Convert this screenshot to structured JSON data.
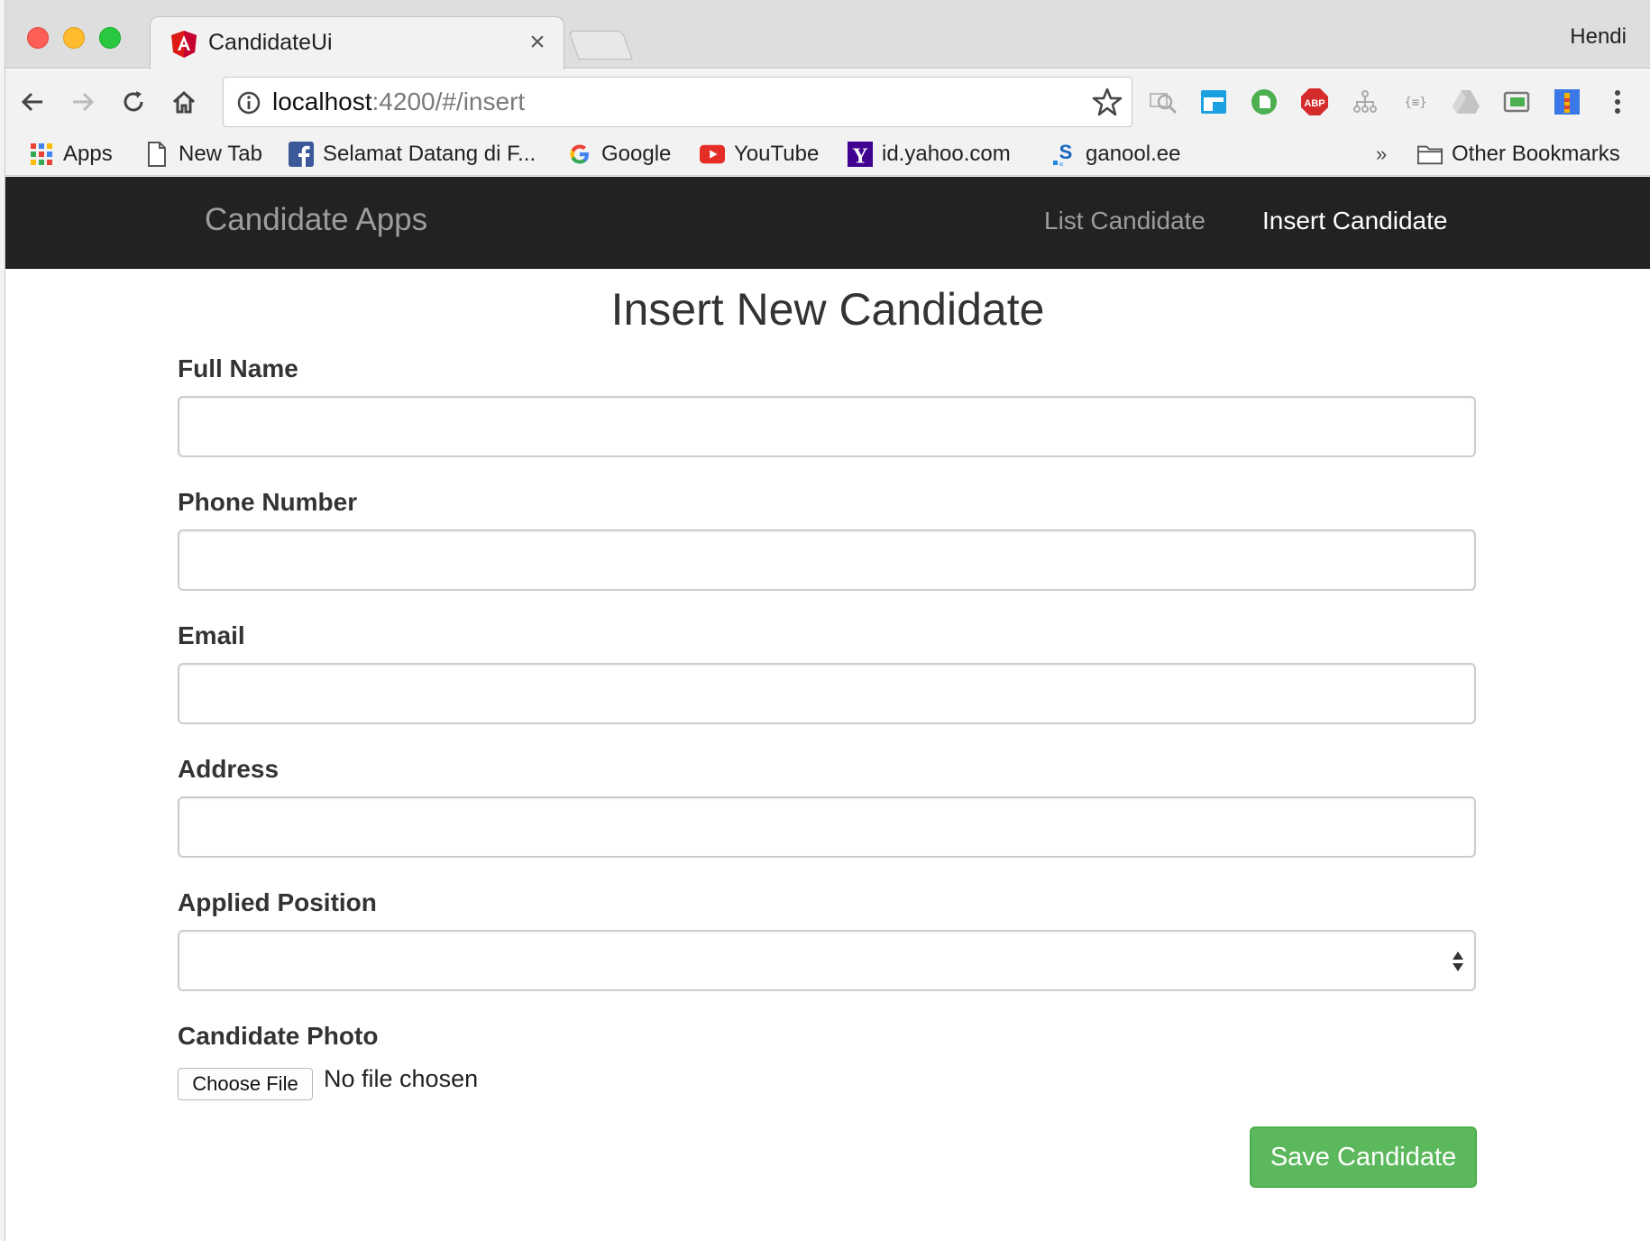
{
  "browser": {
    "tab_title": "CandidateUi",
    "profile_name": "Hendi",
    "url_host": "localhost",
    "url_rest": ":4200/#/insert",
    "close_glyph": "×"
  },
  "bookmarks": {
    "items": [
      {
        "label": "Apps",
        "icon": "apps-grid-icon"
      },
      {
        "label": "New Tab",
        "icon": "page-icon"
      },
      {
        "label": "Selamat Datang di F...",
        "icon": "facebook-icon"
      },
      {
        "label": "Google",
        "icon": "google-icon"
      },
      {
        "label": "YouTube",
        "icon": "youtube-icon"
      },
      {
        "label": "id.yahoo.com",
        "icon": "yahoo-icon"
      },
      {
        "label": "ganool.ee",
        "icon": "ganool-icon"
      }
    ],
    "overflow": "»",
    "other_label": "Other Bookmarks"
  },
  "navbar": {
    "brand": "Candidate Apps",
    "links": [
      {
        "label": "List Candidate",
        "active": false
      },
      {
        "label": "Insert Candidate",
        "active": true
      }
    ]
  },
  "form": {
    "title": "Insert New Candidate",
    "fields": [
      {
        "label": "Full Name",
        "value": ""
      },
      {
        "label": "Phone Number",
        "value": ""
      },
      {
        "label": "Email",
        "value": ""
      },
      {
        "label": "Address",
        "value": ""
      },
      {
        "label": "Applied Position",
        "value": ""
      }
    ],
    "photo_label": "Candidate Photo",
    "file_button": "Choose File",
    "file_status": "No file chosen",
    "submit_label": "Save Candidate"
  },
  "colors": {
    "navbar_bg": "#222222",
    "navbar_muted": "#9d9d9d",
    "success": "#5cb85c"
  }
}
